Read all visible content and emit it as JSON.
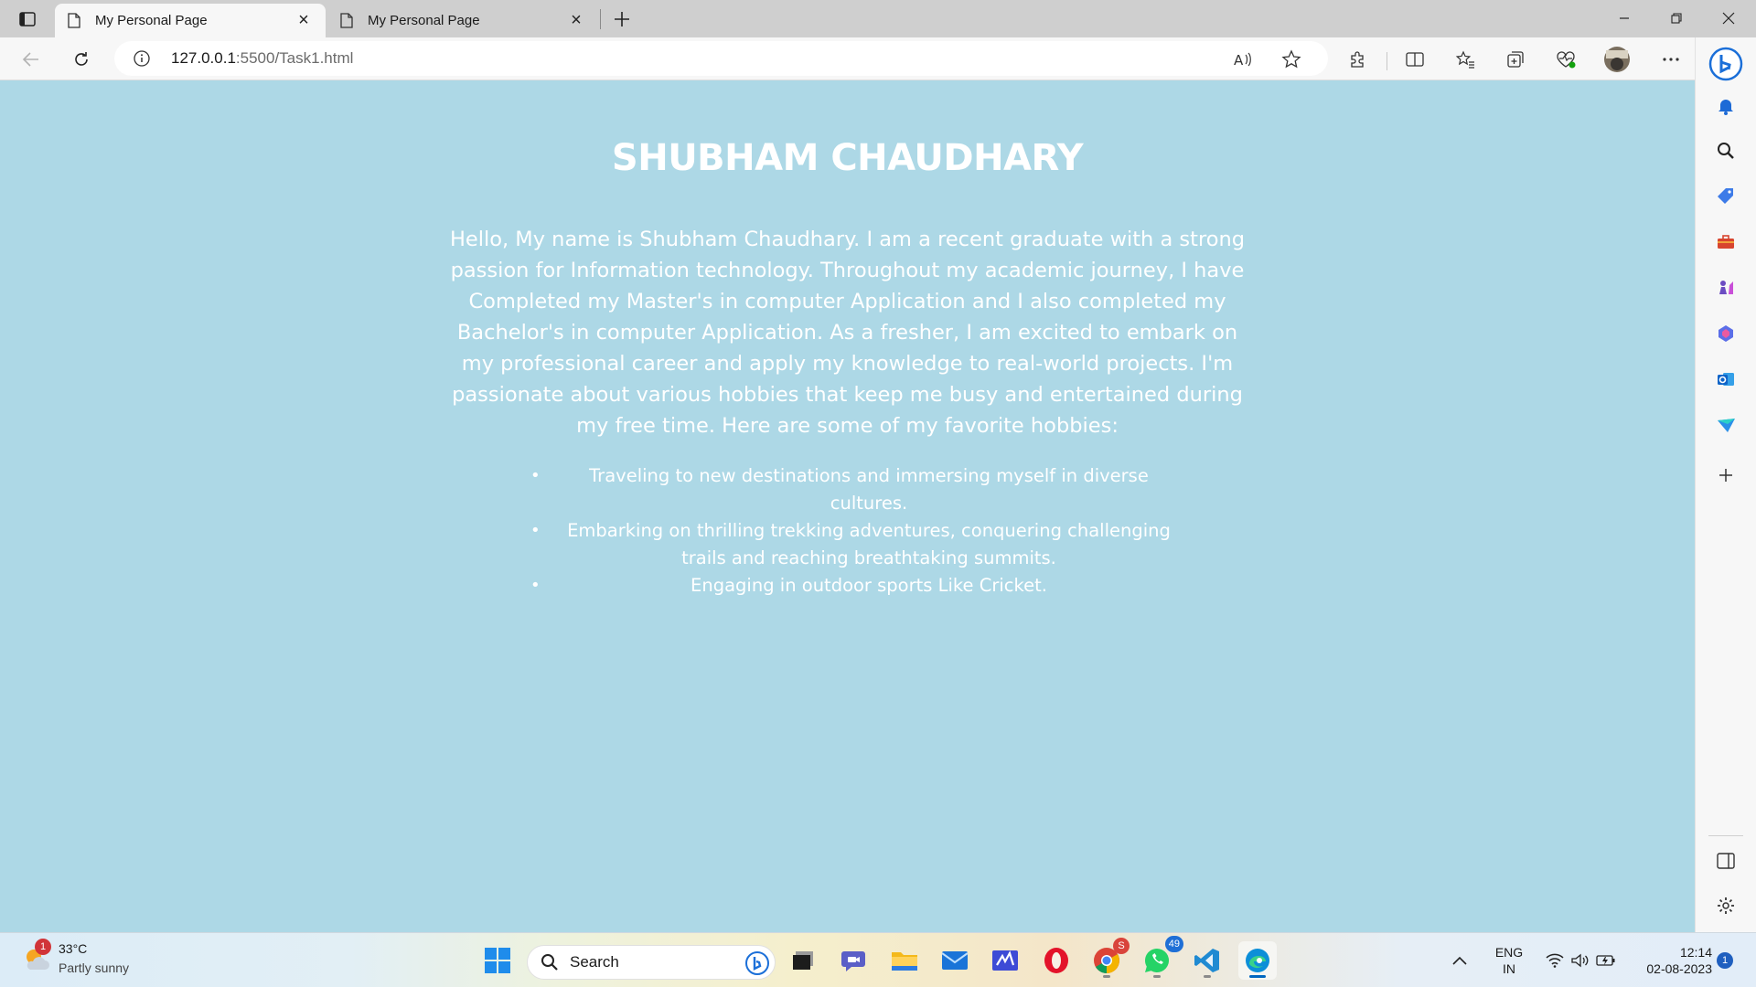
{
  "browser": {
    "tabs": [
      {
        "title": "My Personal Page",
        "active": true
      },
      {
        "title": "My Personal Page",
        "active": false
      }
    ],
    "address": {
      "host": "127.0.0.1",
      "path": ":5500/Task1.html"
    }
  },
  "page": {
    "background": "#add8e6",
    "title": "SHUBHAM CHAUDHARY",
    "intro": "Hello, My name is Shubham Chaudhary. I am a recent graduate with a strong passion for Information technology. Throughout my academic journey, I have Completed my Master's in computer Application and I also completed my Bachelor's in computer Application. As a fresher, I am excited to embark on my professional career and apply my knowledge to real-world projects. I'm passionate about various hobbies that keep me busy and entertained during my free time. Here are some of my favorite hobbies:",
    "hobbies": [
      "Traveling to new destinations and immersing myself in diverse cultures.",
      "Embarking on thrilling trekking adventures, conquering challenging trails and reaching breathtaking summits.",
      "Engaging in outdoor sports Like Cricket."
    ]
  },
  "taskbar": {
    "weather": {
      "temp": "33°C",
      "condition": "Partly sunny",
      "badge": "1"
    },
    "search_label": "Search",
    "chrome_badge": "S",
    "whatsapp_badge": "49",
    "language": {
      "line1": "ENG",
      "line2": "IN"
    },
    "clock": {
      "time": "12:14",
      "date": "02-08-2023"
    },
    "notification_count": "1"
  }
}
